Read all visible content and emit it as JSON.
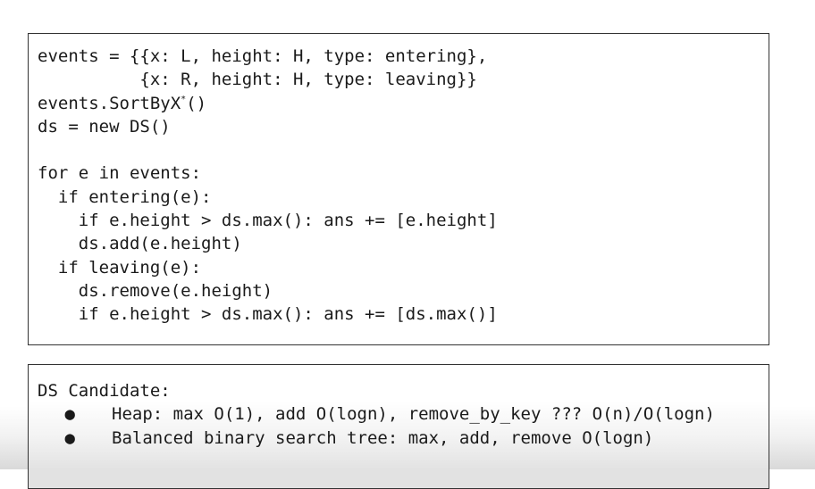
{
  "code": {
    "line1": "events = {{x: L, height: H, type: entering},",
    "line2": "          {x: R, height: H, type: leaving}}",
    "line3_pre": "events.SortByX",
    "line3_sup": "*",
    "line3_post": "()",
    "line4": "ds = new DS()",
    "line6": "for e in events:",
    "line7": "  if entering(e):",
    "line8": "    if e.height > ds.max(): ans += [e.height]",
    "line9": "    ds.add(e.height)",
    "line10": "  if leaving(e):",
    "line11": "    ds.remove(e.height)",
    "line12": "    if e.height > ds.max(): ans += [ds.max()]"
  },
  "ds": {
    "title": "DS Candidate:",
    "bullet_symbol": "●",
    "items": [
      "Heap: max O(1), add O(logn), remove_by_key ??? O(n)/O(logn)",
      "Balanced binary search tree: max, add, remove O(logn)"
    ]
  }
}
